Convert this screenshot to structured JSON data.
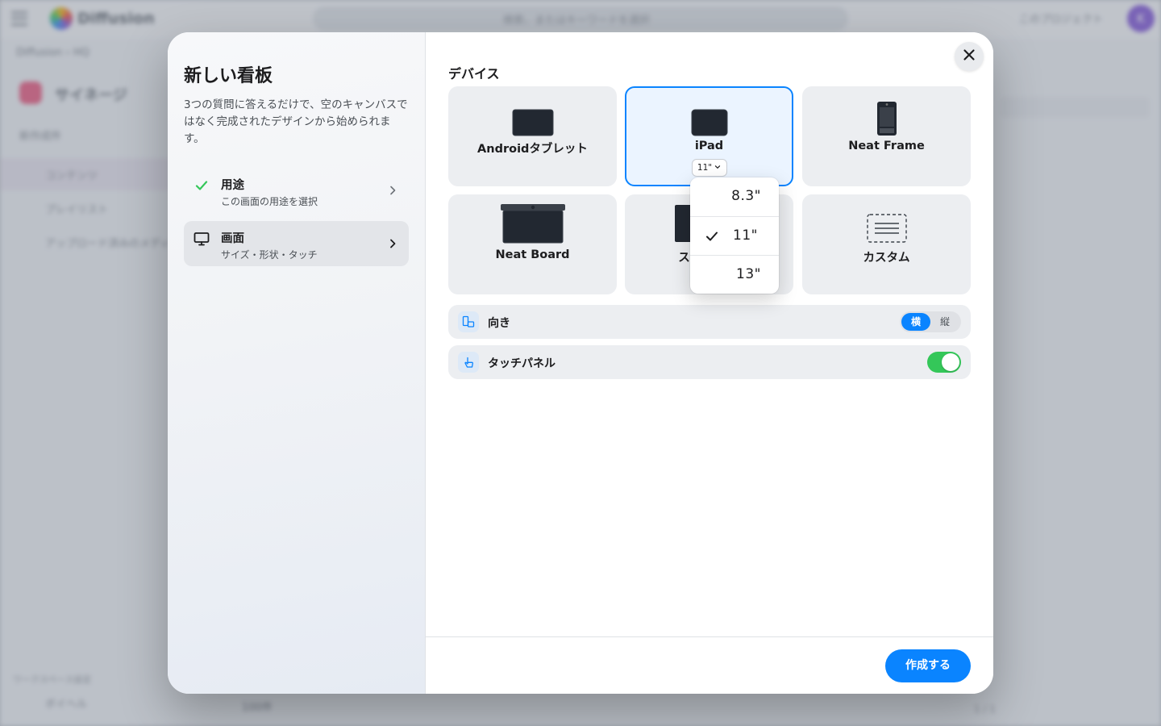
{
  "background": {
    "menu_icon": "hamburger-icon",
    "brand": "Diffusion",
    "search_placeholder": "検索、またはキーワードを選択",
    "project_label": "このプロジェクト",
    "avatar_initial": "K",
    "breadcrumb": "Diffusion  ›  HQ",
    "page_title": "サイネージ",
    "nav_items": [
      "新作成件",
      "コンテンツ",
      "プレイリスト",
      "アップロード済みのメディア"
    ],
    "footer_label": "ワークスペース設定",
    "footer_user": "ボイヘル",
    "bottom_bar": "100件",
    "pager": "1 / 1"
  },
  "modal": {
    "title": "新しい看板",
    "description": "3つの質問に答えるだけで、空のキャンバスではなく完成されたデザインから始められます。",
    "steps": [
      {
        "title": "用途",
        "subtitle": "この画面の用途を選択",
        "icon": "check-icon",
        "state": "done"
      },
      {
        "title": "画面",
        "subtitle": "サイズ・形状・タッチ",
        "icon": "monitor-icon",
        "state": "active"
      }
    ],
    "section_title": "デバイス",
    "devices": [
      {
        "label": "Androidタブレット",
        "icon": "tablet-icon",
        "selected": false
      },
      {
        "label": "iPad",
        "icon": "ipad-icon",
        "selected": true,
        "size": "11\""
      },
      {
        "label": "Neat Frame",
        "icon": "neat-frame-icon",
        "selected": false
      },
      {
        "label": "Neat Board",
        "icon": "neat-board-icon",
        "selected": false
      },
      {
        "label": "ス",
        "icon": "display-icon",
        "selected": false
      },
      {
        "label": "カスタム",
        "icon": "custom-icon",
        "selected": false
      }
    ],
    "size_options": [
      "8.3\"",
      "11\"",
      "13\""
    ],
    "selected_size": "11\"",
    "orientation": {
      "label": "向き",
      "icon": "orientation-icon",
      "options": [
        "横",
        "縦"
      ],
      "selected": "横"
    },
    "touch_panel": {
      "label": "タッチパネル",
      "icon": "touch-icon",
      "enabled": true
    },
    "create_button": "作成する",
    "close_icon": "close-icon",
    "colors": {
      "accent": "#0a84ff",
      "toggle_on": "#34c759",
      "check": "#34c759"
    }
  }
}
